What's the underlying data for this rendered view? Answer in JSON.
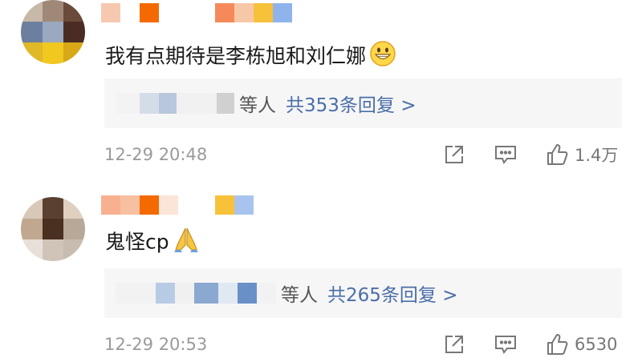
{
  "comments": [
    {
      "text": "我有点期待是李栋旭和刘仁娜",
      "emoji": "grinning-face",
      "replies": {
        "suffix": "等人",
        "link": "共353条回复 >"
      },
      "timestamp": "12-29 20:48",
      "like_count": "1.4万"
    },
    {
      "text": "鬼怪cp",
      "emoji": "folded-hands",
      "replies": {
        "suffix": "等人",
        "link": "共265条回复 >"
      },
      "timestamp": "12-29 20:53",
      "like_count": "6530"
    }
  ],
  "colors": {
    "link": "#4a6ea8",
    "timestamp": "#9a9a9a",
    "reply_bg": "#f6f6f6",
    "name_blocks": [
      "#f7a882",
      "#f46a00",
      "#f5895a",
      "#f7c8a8",
      "#f7c13a",
      "#8fb4ec"
    ]
  }
}
